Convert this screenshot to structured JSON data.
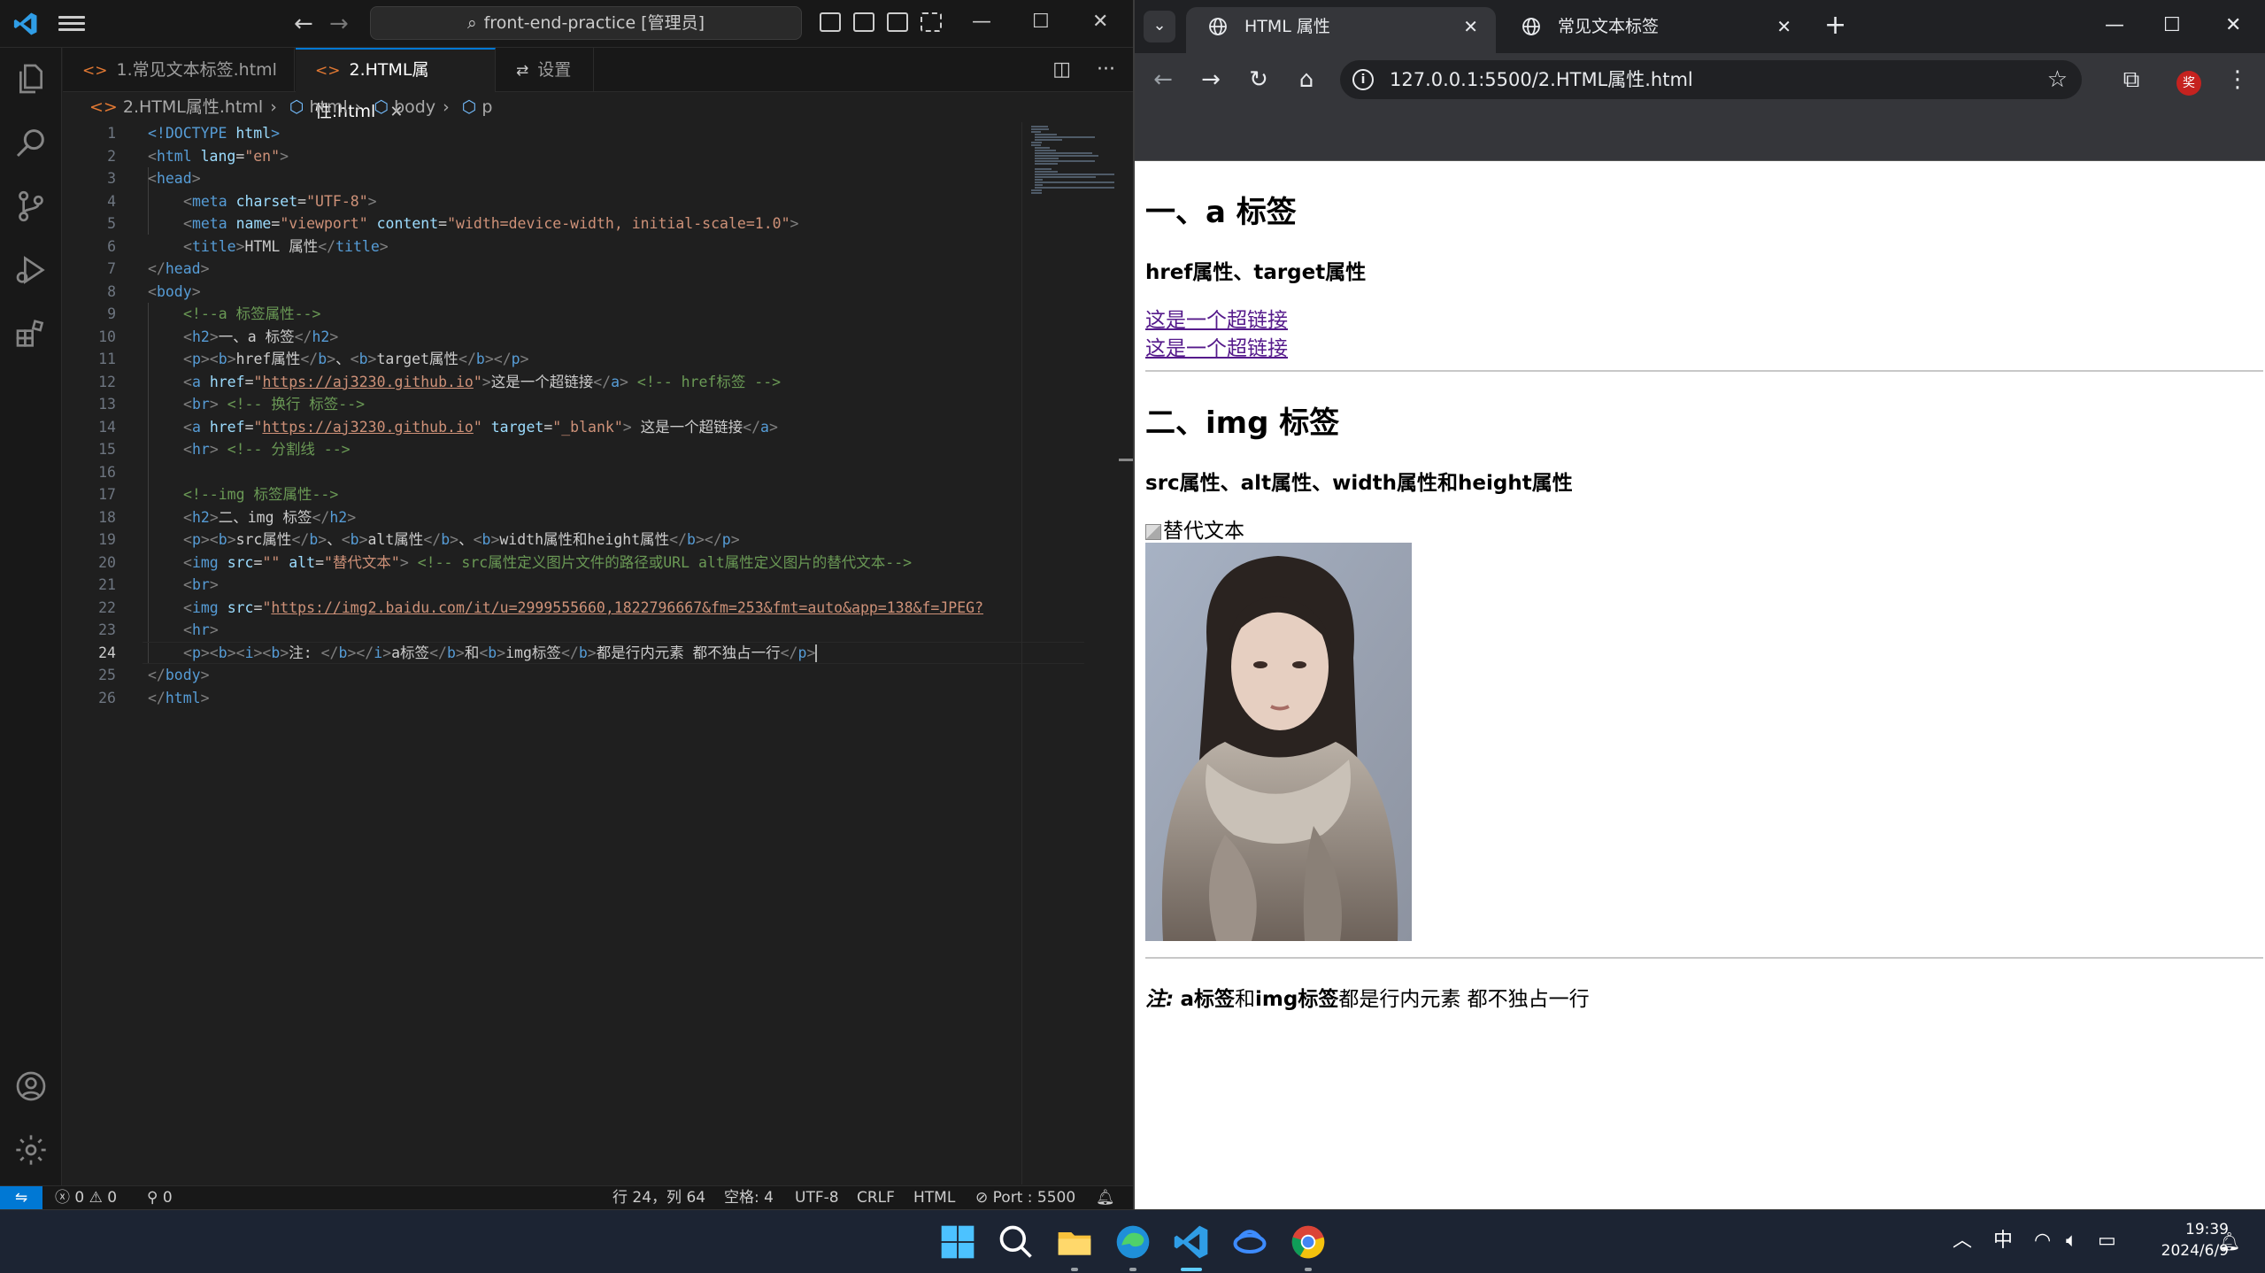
{
  "vscode": {
    "search_text": "front-end-practice [管理员]",
    "tabs": [
      {
        "label": "1.常见文本标签.html",
        "icon": "html-file-icon"
      },
      {
        "label": "2.HTML属性.html",
        "icon": "html-file-icon",
        "active": true
      },
      {
        "label": "设置",
        "icon": "settings-icon"
      }
    ],
    "breadcrumb": [
      "2.HTML属性.html",
      "html",
      "body",
      "p"
    ],
    "code_lines": [
      {
        "n": "1",
        "html": "<span class='tag'>&lt;!DOCTYPE</span> <span class='attr'>html</span><span class='tag'>&gt;</span>",
        "indent": 0
      },
      {
        "n": "2",
        "html": "<span class='lt'>&lt;</span><span class='tag'>html</span> <span class='attr'>lang</span>=<span class='str'>\"en\"</span><span class='lt'>&gt;</span>",
        "indent": 0
      },
      {
        "n": "3",
        "html": "<span class='lt'>&lt;</span><span class='tag'>head</span><span class='lt'>&gt;</span>",
        "indent": 0
      },
      {
        "n": "4",
        "html": "<span class='lt'>&lt;</span><span class='tag'>meta</span> <span class='attr'>charset</span>=<span class='str'>\"UTF-8\"</span><span class='lt'>&gt;</span>",
        "indent": 1
      },
      {
        "n": "5",
        "html": "<span class='lt'>&lt;</span><span class='tag'>meta</span> <span class='attr'>name</span>=<span class='str'>\"viewport\"</span> <span class='attr'>content</span>=<span class='str'>\"width=device-width, initial-scale=1.0\"</span><span class='lt'>&gt;</span>",
        "indent": 1
      },
      {
        "n": "6",
        "html": "<span class='lt'>&lt;</span><span class='tag'>title</span><span class='lt'>&gt;</span>HTML 属性<span class='lt'>&lt;/</span><span class='tag'>title</span><span class='lt'>&gt;</span>",
        "indent": 1
      },
      {
        "n": "7",
        "html": "<span class='lt'>&lt;/</span><span class='tag'>head</span><span class='lt'>&gt;</span>",
        "indent": 0
      },
      {
        "n": "8",
        "html": "<span class='lt'>&lt;</span><span class='tag'>body</span><span class='lt'>&gt;</span>",
        "indent": 0
      },
      {
        "n": "9",
        "html": "<span class='com'>&lt;!--a 标签属性--&gt;</span>",
        "indent": 1
      },
      {
        "n": "10",
        "html": "<span class='lt'>&lt;</span><span class='tag'>h2</span><span class='lt'>&gt;</span>一、a 标签<span class='lt'>&lt;/</span><span class='tag'>h2</span><span class='lt'>&gt;</span>",
        "indent": 1
      },
      {
        "n": "11",
        "html": "<span class='lt'>&lt;</span><span class='tag'>p</span><span class='lt'>&gt;&lt;</span><span class='tag'>b</span><span class='lt'>&gt;</span>href属性<span class='lt'>&lt;/</span><span class='tag'>b</span><span class='lt'>&gt;</span>、<span class='lt'>&lt;</span><span class='tag'>b</span><span class='lt'>&gt;</span>target属性<span class='lt'>&lt;/</span><span class='tag'>b</span><span class='lt'>&gt;&lt;/</span><span class='tag'>p</span><span class='lt'>&gt;</span>",
        "indent": 1
      },
      {
        "n": "12",
        "html": "<span class='lt'>&lt;</span><span class='tag'>a</span> <span class='attr'>href</span>=<span class='str'>\"</span><span class='url'>https://aj3230.github.io</span><span class='str'>\"</span><span class='lt'>&gt;</span>这是一个超链接<span class='lt'>&lt;/</span><span class='tag'>a</span><span class='lt'>&gt;</span> <span class='com'>&lt;!-- href标签 --&gt;</span>",
        "indent": 1
      },
      {
        "n": "13",
        "html": "<span class='lt'>&lt;</span><span class='tag'>br</span><span class='lt'>&gt;</span> <span class='com'>&lt;!-- 换行 标签--&gt;</span>",
        "indent": 1
      },
      {
        "n": "14",
        "html": "<span class='lt'>&lt;</span><span class='tag'>a</span> <span class='attr'>href</span>=<span class='str'>\"</span><span class='url'>https://aj3230.github.io</span><span class='str'>\"</span> <span class='attr'>target</span>=<span class='str'>\"_blank\"</span><span class='lt'>&gt;</span> 这是一个超链接<span class='lt'>&lt;/</span><span class='tag'>a</span><span class='lt'>&gt;</span>",
        "indent": 1
      },
      {
        "n": "15",
        "html": "<span class='lt'>&lt;</span><span class='tag'>hr</span><span class='lt'>&gt;</span> <span class='com'>&lt;!-- 分割线 --&gt;</span>",
        "indent": 1
      },
      {
        "n": "16",
        "html": "",
        "indent": 0
      },
      {
        "n": "17",
        "html": "<span class='com'>&lt;!--img 标签属性--&gt;</span>",
        "indent": 1
      },
      {
        "n": "18",
        "html": "<span class='lt'>&lt;</span><span class='tag'>h2</span><span class='lt'>&gt;</span>二、img 标签<span class='lt'>&lt;/</span><span class='tag'>h2</span><span class='lt'>&gt;</span>",
        "indent": 1
      },
      {
        "n": "19",
        "html": "<span class='lt'>&lt;</span><span class='tag'>p</span><span class='lt'>&gt;&lt;</span><span class='tag'>b</span><span class='lt'>&gt;</span>src属性<span class='lt'>&lt;/</span><span class='tag'>b</span><span class='lt'>&gt;</span>、<span class='lt'>&lt;</span><span class='tag'>b</span><span class='lt'>&gt;</span>alt属性<span class='lt'>&lt;/</span><span class='tag'>b</span><span class='lt'>&gt;</span>、<span class='lt'>&lt;</span><span class='tag'>b</span><span class='lt'>&gt;</span>width属性和height属性<span class='lt'>&lt;/</span><span class='tag'>b</span><span class='lt'>&gt;&lt;/</span><span class='tag'>p</span><span class='lt'>&gt;</span>",
        "indent": 1
      },
      {
        "n": "20",
        "html": "<span class='lt'>&lt;</span><span class='tag'>img</span> <span class='attr'>src</span>=<span class='str'>\"\"</span> <span class='attr'>alt</span>=<span class='str'>\"替代文本\"</span><span class='lt'>&gt;</span> <span class='com'>&lt;!-- src属性定义图片文件的路径或URL alt属性定义图片的替代文本--&gt;</span>",
        "indent": 1
      },
      {
        "n": "21",
        "html": "<span class='lt'>&lt;</span><span class='tag'>br</span><span class='lt'>&gt;</span>",
        "indent": 1
      },
      {
        "n": "22",
        "html": "<span class='lt'>&lt;</span><span class='tag'>img</span> <span class='attr'>src</span>=<span class='str'>\"</span><span class='url'>https://img2.baidu.com/it/u=2999555660,1822796667&amp;fm=253&amp;fmt=auto&amp;app=138&amp;f=JPEG?</span>",
        "indent": 1
      },
      {
        "n": "23",
        "html": "<span class='lt'>&lt;</span><span class='tag'>hr</span><span class='lt'>&gt;</span>",
        "indent": 1
      },
      {
        "n": "24",
        "html": "<span class='lt'>&lt;</span><span class='tag'>p</span><span class='lt'>&gt;&lt;</span><span class='tag'>b</span><span class='lt'>&gt;&lt;</span><span class='tag'>i</span><span class='lt'>&gt;&lt;</span><span class='tag'>b</span><span class='lt'>&gt;</span>注: <span class='lt'>&lt;/</span><span class='tag'>b</span><span class='lt'>&gt;&lt;/</span><span class='tag'>i</span><span class='lt'>&gt;</span>a标签<span class='lt'>&lt;/</span><span class='tag'>b</span><span class='lt'>&gt;</span>和<span class='lt'>&lt;</span><span class='tag'>b</span><span class='lt'>&gt;</span>img标签<span class='lt'>&lt;/</span><span class='tag'>b</span><span class='lt'>&gt;</span>都是行内元素 都不独占一行<span class='lt'>&lt;/</span><span class='tag'>p</span><span class='lt'>&gt;</span><span class='cursor'></span>",
        "indent": 1,
        "current": true
      },
      {
        "n": "25",
        "html": "<span class='lt'>&lt;/</span><span class='tag'>body</span><span class='lt'>&gt;</span>",
        "indent": 0
      },
      {
        "n": "26",
        "html": "<span class='lt'>&lt;/</span><span class='tag'>html</span><span class='lt'>&gt;</span>",
        "indent": 0
      }
    ],
    "status": {
      "errors": "0",
      "warnings": "0",
      "ports": "0",
      "position": "行 24，列 64",
      "spaces": "空格: 4",
      "encoding": "UTF-8",
      "eol": "CRLF",
      "language": "HTML",
      "live_server": "Port : 5500"
    }
  },
  "chrome": {
    "tabs": [
      {
        "label": "HTML 属性",
        "active": true
      },
      {
        "label": "常见文本标签",
        "active": false
      }
    ],
    "url": "127.0.0.1:5500/2.HTML属性.html",
    "profile_badge": "奖"
  },
  "page": {
    "h2_a": "一、a 标签",
    "p_a": "href属性、target属性",
    "link1": "这是一个超链接",
    "link2": "这是一个超链接",
    "h2_img": "二、img 标签",
    "p_img": "src属性、alt属性、width属性和height属性",
    "alt_text": "替代文本",
    "note_label": "注:",
    "note_a": "a标签",
    "note_and": "和",
    "note_img": "img标签",
    "note_rest": "都是行内元素 都不独占一行"
  },
  "taskbar": {
    "time": "19:39",
    "date": "2024/6/9",
    "ime": "中"
  }
}
